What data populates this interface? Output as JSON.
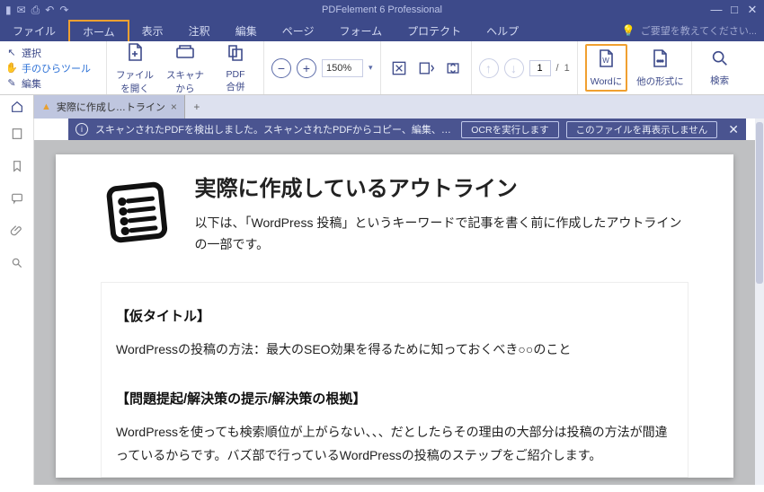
{
  "app": {
    "title": "PDFelement 6 Professional"
  },
  "window_controls": {
    "min": "—",
    "max": "□",
    "close": "✕"
  },
  "menu": {
    "items": [
      "ファイル",
      "ホーム",
      "表示",
      "注釈",
      "編集",
      "ページ",
      "フォーム",
      "プロテクト",
      "ヘルプ"
    ],
    "active_index": 1,
    "hint": "ご要望を教えてください..."
  },
  "ribbon_left": {
    "select": "選択",
    "hand": "手のひらツール",
    "edit": "編集"
  },
  "ribbon": {
    "open_file": "ファイル\nを開く",
    "from_scanner": "スキャナ\nから",
    "pdf_merge": "PDF\n合併",
    "zoom_value": "150%",
    "page_current": "1",
    "page_sep": "/",
    "page_total": "1",
    "to_word": "Wordに",
    "to_other": "他の形式に",
    "search": "検索"
  },
  "tabs": {
    "doc_title": "実際に作成し…トライン",
    "close": "×",
    "add": "+"
  },
  "banner": {
    "message": "スキャンされたPDFを検出しました。スキャンされたPDFからコピー、編集、テキストを検...",
    "ocr_btn": "OCRを実行します",
    "dismiss_btn": "このファイルを再表示しません"
  },
  "document": {
    "title": "実際に作成しているアウトライン",
    "intro": "以下は、「WordPress 投稿」というキーワードで記事を書く前に作成したアウトラインの一部です。",
    "sec1_h": "【仮タイトル】",
    "sec1_p": "WordPressの投稿の方法：最大のSEO効果を得るために知っておくべき○○のこと",
    "sec2_h": "【問題提起/解決策の提示/解決策の根拠】",
    "sec2_p": "WordPressを使っても検索順位が上がらない、、、だとしたらその理由の大部分は投稿の方法が間違っているからです。バズ部で行っているWordPressの投稿のステップをご紹介します。"
  }
}
